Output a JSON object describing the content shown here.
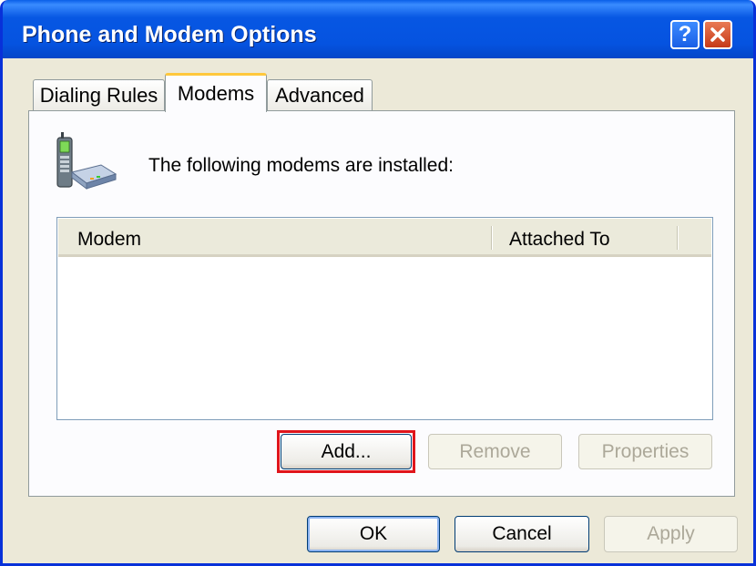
{
  "window": {
    "title": "Phone and Modem Options"
  },
  "titlebar_buttons": {
    "help": "?",
    "close_icon": "close-x"
  },
  "tabs": [
    {
      "label": "Dialing Rules",
      "active": false
    },
    {
      "label": "Modems",
      "active": true
    },
    {
      "label": "Advanced",
      "active": false
    }
  ],
  "modems_tab": {
    "icon": "phone-modem-icon",
    "intro_text": "The following modems are  installed:",
    "list_columns": [
      "Modem",
      "Attached To"
    ],
    "rows": [],
    "buttons": {
      "add": "Add...",
      "remove": "Remove",
      "properties": "Properties"
    }
  },
  "dialog_buttons": {
    "ok": "OK",
    "cancel": "Cancel",
    "apply": "Apply"
  },
  "colors": {
    "title_bar": "#0553E0",
    "dialog_bg": "#ECE9D8",
    "highlight": "#E0151B",
    "active_tab_accent": "#FFC83C"
  }
}
